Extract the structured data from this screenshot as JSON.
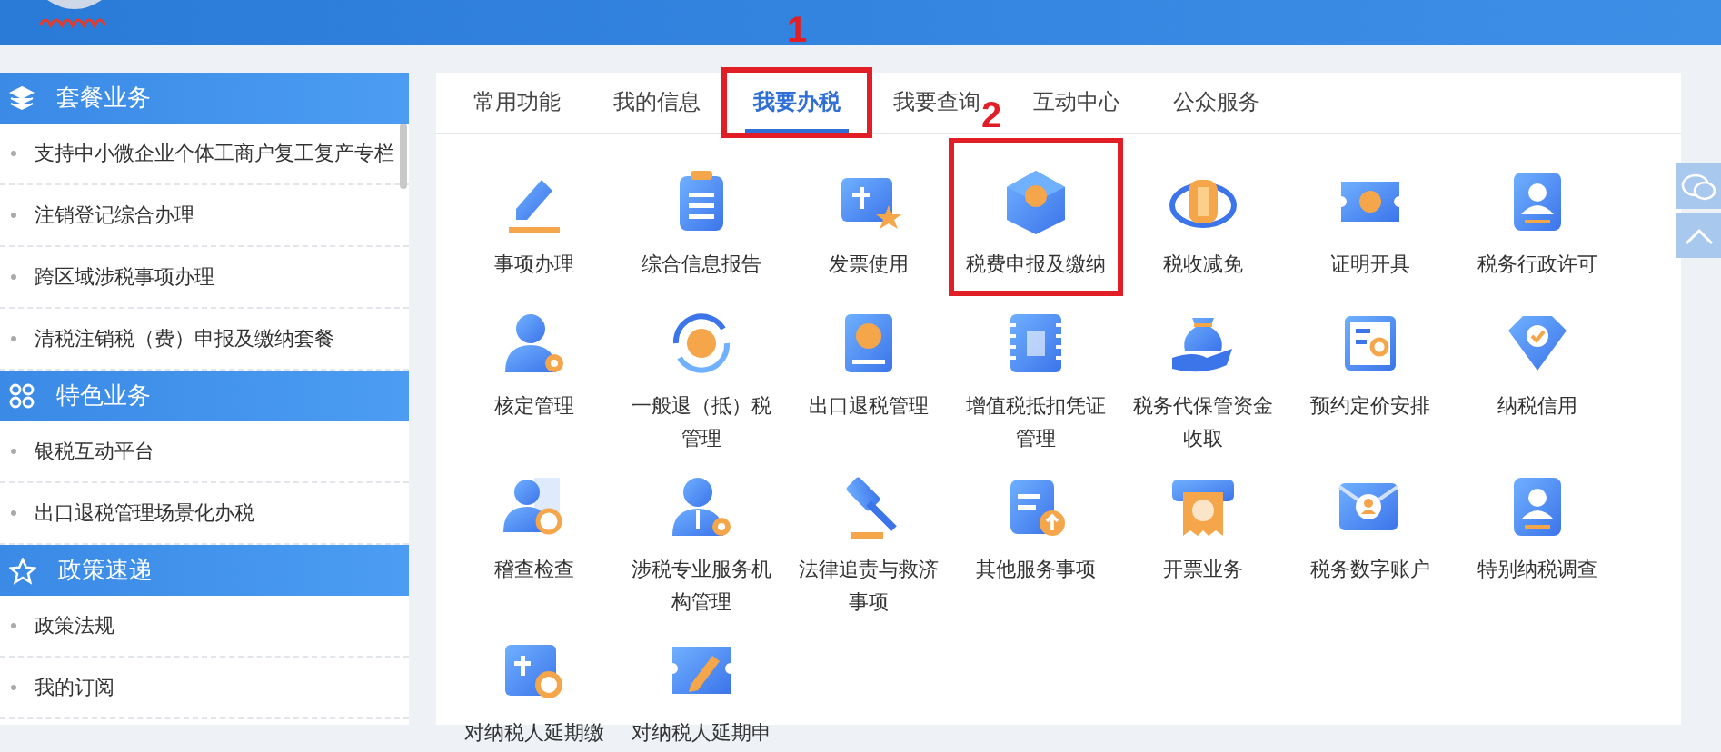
{
  "sidebar": {
    "sections": [
      {
        "title": "套餐业务",
        "kind": "layers",
        "items": [
          "支持中小微企业个体工商户复工复产专栏",
          "注销登记综合办理",
          "跨区域涉税事项办理",
          "清税注销税（费）申报及缴纳套餐"
        ]
      },
      {
        "title": "特色业务",
        "kind": "grid",
        "items": [
          "银税互动平台",
          "出口退税管理场景化办税"
        ]
      },
      {
        "title": "政策速递",
        "kind": "star",
        "items": [
          "政策法规",
          "我的订阅"
        ]
      }
    ]
  },
  "tabs": [
    {
      "label": "常用功能",
      "selected": false
    },
    {
      "label": "我的信息",
      "selected": false
    },
    {
      "label": "我要办税",
      "selected": true,
      "annotation": "1"
    },
    {
      "label": "我要查询",
      "selected": false
    },
    {
      "label": "互动中心",
      "selected": false
    },
    {
      "label": "公众服务",
      "selected": false
    }
  ],
  "services": [
    {
      "label": "事项办理"
    },
    {
      "label": "综合信息报告"
    },
    {
      "label": "发票使用"
    },
    {
      "label": "税费申报及缴纳",
      "annotation": "2"
    },
    {
      "label": "税收减免"
    },
    {
      "label": "证明开具"
    },
    {
      "label": "税务行政许可"
    },
    {
      "label": "核定管理"
    },
    {
      "label": "一般退（抵）税管理"
    },
    {
      "label": "出口退税管理"
    },
    {
      "label": "增值税抵扣凭证管理"
    },
    {
      "label": "税务代保管资金收取"
    },
    {
      "label": "预约定价安排"
    },
    {
      "label": "纳税信用"
    },
    {
      "label": "稽查检查"
    },
    {
      "label": "涉税专业服务机构管理"
    },
    {
      "label": "法律追责与救济事项"
    },
    {
      "label": "其他服务事项"
    },
    {
      "label": "开票业务"
    },
    {
      "label": "税务数字账户"
    },
    {
      "label": "特别纳税调查"
    },
    {
      "label": "对纳税人延期缴"
    },
    {
      "label": "对纳税人延期申"
    }
  ]
}
